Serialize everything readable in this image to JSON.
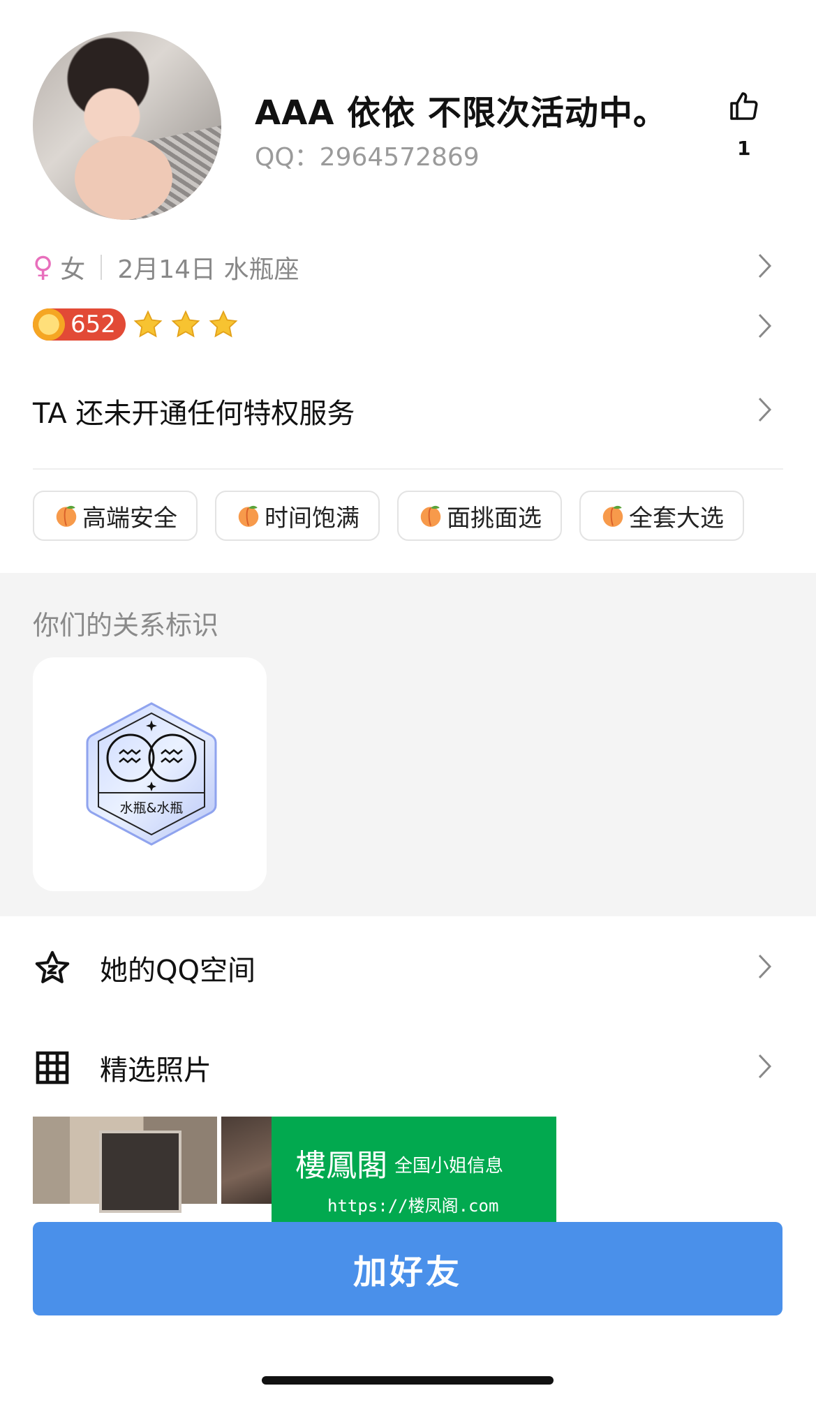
{
  "profile": {
    "name": "AAA 依依 不限次活动中。",
    "qq": "QQ：2964572869",
    "like_count": "1",
    "gender_symbol": "♀",
    "gender": "女",
    "birthday": "2月14日 水瓶座",
    "level": "652",
    "stars": 3,
    "privilege": "TA 还未开通任何特权服务"
  },
  "tags": [
    {
      "label": "高端安全"
    },
    {
      "label": "时间饱满"
    },
    {
      "label": "面挑面选"
    },
    {
      "label": "全套大选"
    }
  ],
  "relationship": {
    "title": "你们的关系标识",
    "badge_label": "水瓶&水瓶"
  },
  "menu": {
    "qzone": "她的QQ空间",
    "photos": "精选照片"
  },
  "watermark": {
    "title": "樓鳳閣",
    "subtitle": "全国小姐信息",
    "url": "https://楼凤阁.com"
  },
  "actions": {
    "add_friend": "加好友"
  },
  "colors": {
    "accent_blue": "#4a90ea",
    "watermark_green": "#02a94f",
    "level_red": "#e24a36",
    "gender_pink": "#e86fbc"
  }
}
